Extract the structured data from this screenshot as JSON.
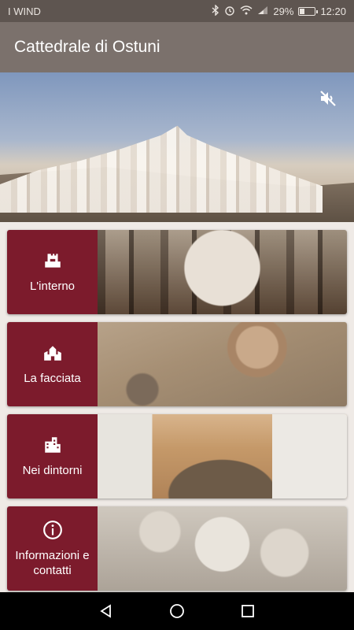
{
  "status_bar": {
    "carrier": "I WIND",
    "battery": "29%",
    "time": "12:20",
    "battery_level": 0.29,
    "icons": [
      "bluetooth-icon",
      "alarm-icon",
      "wifi-icon",
      "signal-icon",
      "battery-icon"
    ]
  },
  "app_bar": {
    "title": "Cattedrale di Ostuni"
  },
  "hero": {
    "mute_icon": "volume-off-icon"
  },
  "cards": [
    {
      "label": "L'interno",
      "icon": "castle-icon"
    },
    {
      "label": "La facciata",
      "icon": "church-icon"
    },
    {
      "label": "Nei dintorni",
      "icon": "city-icon"
    },
    {
      "label": "Informazioni e contatti",
      "icon": "info-icon"
    }
  ],
  "nav_bar": {
    "icons": [
      "back-icon",
      "home-icon",
      "recents-icon"
    ]
  },
  "colors": {
    "status_bar": "#5e5550",
    "app_bar": "#7b716c",
    "accent": "#7c1b2c",
    "background": "#efeae6"
  }
}
